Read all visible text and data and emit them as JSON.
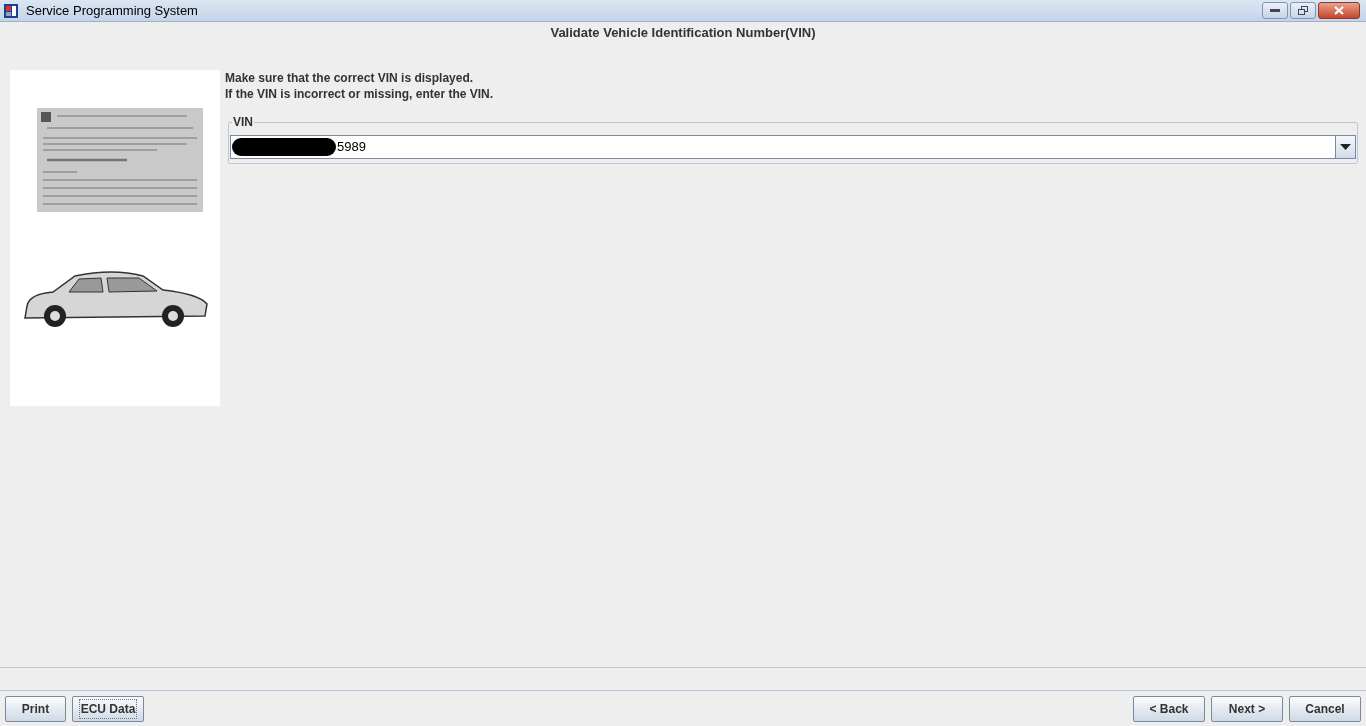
{
  "window": {
    "title": "Service Programming System"
  },
  "header": {
    "title": "Validate Vehicle Identification Number(VIN)"
  },
  "instructions": [
    "Make sure that the correct VIN is displayed.",
    "If the VIN is incorrect or missing, enter the VIN."
  ],
  "vin_group": {
    "label": "VIN",
    "value": "5989",
    "redacted": true
  },
  "buttons_left": [
    {
      "label": "Print",
      "focused": false
    },
    {
      "label": "ECU Data",
      "focused": true
    }
  ],
  "buttons_right": [
    {
      "label": "< Back",
      "focused": false
    },
    {
      "label": "Next >",
      "focused": false
    },
    {
      "label": "Cancel",
      "focused": false
    }
  ]
}
